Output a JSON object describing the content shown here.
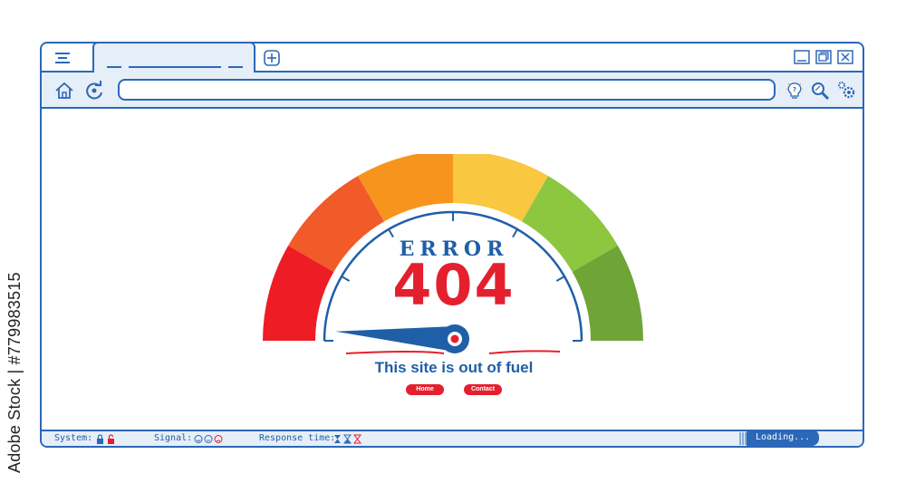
{
  "watermark": "Adobe Stock | #779983515",
  "window": {
    "tab": {
      "title": ""
    },
    "controls": [
      "minimize-icon",
      "maximize-icon",
      "close-icon"
    ],
    "toolbar": {
      "left_icons": [
        "home-icon",
        "reload-icon"
      ],
      "address_value": "",
      "right_icons": [
        "lightbulb-question-icon",
        "search-icon",
        "settings-gears-icon"
      ]
    }
  },
  "error_page": {
    "label": "ERROR",
    "code": "404",
    "message": "This site is out of fuel",
    "buttons": {
      "home": "Home",
      "contact": "Contact"
    },
    "gauge": {
      "segment_colors": [
        "#ee1c25",
        "#f15a29",
        "#f7941d",
        "#f9c740",
        "#8dc63f",
        "#6fa536"
      ],
      "needle_color": "#1f5fa8",
      "needle_level": 0.02
    }
  },
  "statusbar": {
    "system_label": "System:",
    "system_icons": [
      "lock-closed-icon",
      "lock-open-icon"
    ],
    "signal_label": "Signal:",
    "signal_icons": [
      "smile-icon",
      "neutral-face-icon",
      "sad-face-icon"
    ],
    "response_label": "Response time:",
    "response_icons": [
      "hourglass-full-icon",
      "hourglass-half-icon",
      "hourglass-empty-icon"
    ],
    "loading": "Loading..."
  },
  "colors": {
    "accent": "#2b68b8",
    "panel": "#e6eef8",
    "error": "#e5202e"
  }
}
